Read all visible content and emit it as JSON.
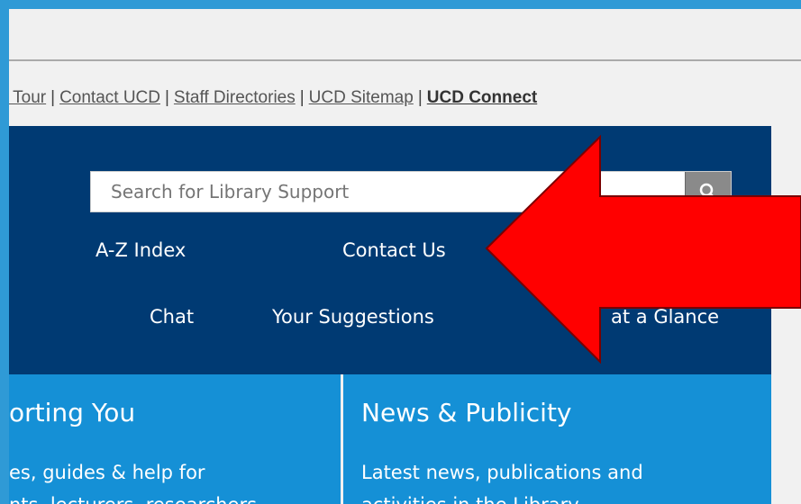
{
  "utility_links": [
    {
      "label": "l Tour",
      "bold": false
    },
    {
      "label": "Contact UCD",
      "bold": false
    },
    {
      "label": "Staff Directories",
      "bold": false
    },
    {
      "label": "UCD Sitemap",
      "bold": false
    },
    {
      "label": "UCD Connect",
      "bold": true
    }
  ],
  "utility_separator": "|",
  "search": {
    "placeholder": "Search for Library Support",
    "button_icon": "search-icon"
  },
  "nav": {
    "az_index": "A-Z Index",
    "contact_us": "Contact Us",
    "chat": "Chat",
    "your_suggestions": "Your Suggestions",
    "at_a_glance": "at a Glance"
  },
  "panels": {
    "left": {
      "title": "orting You",
      "line1": "es, guides & help for",
      "line2": "nts, lecturers, researchers"
    },
    "right": {
      "title": "News & Publicity",
      "line1": "Latest news, publications and",
      "line2": "activities in the Library"
    }
  },
  "colors": {
    "frame_blue": "#2f9ad6",
    "header_navy": "#003a73",
    "panel_blue": "#1590d6",
    "arrow_red": "#ff0000"
  }
}
